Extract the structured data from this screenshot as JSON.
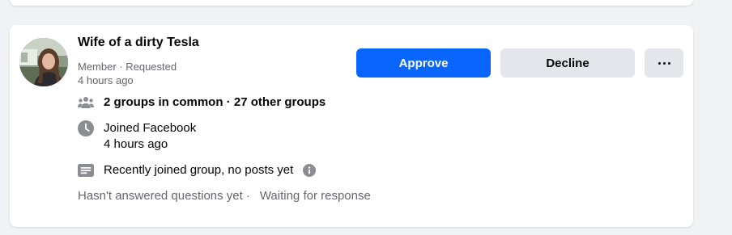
{
  "member": {
    "name": "Wife of a dirty Tesla",
    "role_status": "Member · Requested",
    "requested_time": "4 hours ago"
  },
  "actions": {
    "approve_label": "Approve",
    "decline_label": "Decline",
    "more_icon": "more-horizontal-icon"
  },
  "details": {
    "groups_in_common": "2 groups in common",
    "groups_separator": " · ",
    "other_groups": "27 other groups",
    "joined_label": "Joined Facebook",
    "joined_time": "4 hours ago",
    "activity": "Recently joined group, no posts yet"
  },
  "footer": {
    "questions_status": "Hasn't answered questions yet",
    "separator": "·",
    "response_status": "Waiting for response"
  },
  "colors": {
    "primary": "#0866ff",
    "secondary_bg": "#e4e6eb",
    "secondary_text": "#65676b",
    "page_bg": "#f0f2f5"
  }
}
